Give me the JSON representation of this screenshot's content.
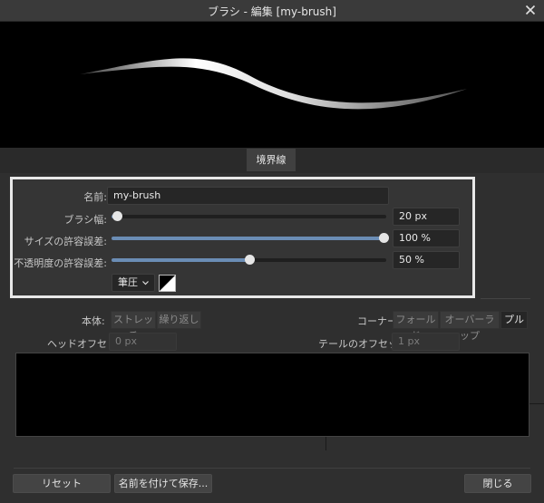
{
  "window": {
    "title": "ブラシ - 編集 [my-brush]",
    "close_icon": "close-icon"
  },
  "tabs": [
    {
      "label": "境界線"
    }
  ],
  "form": {
    "name_label": "名前:",
    "name_value": "my-brush",
    "width_label": "ブラシ幅:",
    "width_value": "20 px",
    "width_level": 0.02,
    "size_var_label": "サイズの許容誤差:",
    "size_var_value": "100 %",
    "size_var_level": 1.0,
    "opacity_var_label": "不透明度の許容誤差:",
    "opacity_var_value": "50 %",
    "opacity_var_level": 0.5,
    "pressure_label": "筆圧",
    "pressure_icon": "chevron-down-icon",
    "curve_icon": "pressure-curve-icon"
  },
  "texture": {
    "body_label": "本体:",
    "body_options": [
      "ストレッチ",
      "繰り返し"
    ],
    "corner_label": "コーナー:",
    "corner_options": [
      "フォールド",
      "オーバーラップ",
      "プル"
    ],
    "head_offset_label": "ヘッドオフセット:",
    "head_offset_value": "0 px",
    "tail_offset_label": "テールのオフセット:",
    "tail_offset_value": "1 px"
  },
  "footer": {
    "reset": "リセット",
    "save_as": "名前を付けて保存...",
    "close": "閉じる"
  },
  "colors": {
    "accent": "#6b8db5",
    "highlight_border": "#e8e8e8"
  }
}
